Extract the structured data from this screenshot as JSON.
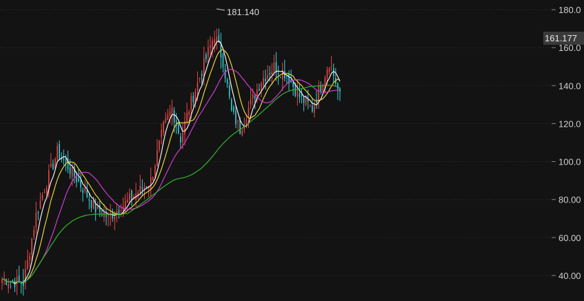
{
  "chart_data": {
    "type": "candlestick",
    "y_axis": {
      "ticks": [
        180,
        160,
        140,
        120,
        100,
        80,
        60,
        40
      ],
      "tick_labels": [
        "180.0",
        "160.0",
        "140.0",
        "120.0",
        "100.0",
        "80.00",
        "60.00",
        "40.00"
      ],
      "ylim": [
        33,
        183
      ],
      "position": "right"
    },
    "grid": "horizontal-dotted",
    "annotations": {
      "peak_label": "181.140",
      "peak_value": 181.14,
      "current_price_label": "161.177",
      "current_price": 161.177
    },
    "bar_count": 160,
    "price_path_anchors": [
      [
        0,
        38
      ],
      [
        10,
        36
      ],
      [
        12,
        47
      ],
      [
        16,
        72
      ],
      [
        20,
        86
      ],
      [
        26,
        105
      ],
      [
        32,
        96
      ],
      [
        38,
        86
      ],
      [
        44,
        75
      ],
      [
        50,
        71
      ],
      [
        56,
        76
      ],
      [
        62,
        82
      ],
      [
        70,
        90
      ],
      [
        76,
        118
      ],
      [
        80,
        128
      ],
      [
        84,
        112
      ],
      [
        88,
        128
      ],
      [
        94,
        148
      ],
      [
        100,
        167
      ],
      [
        104,
        153
      ],
      [
        108,
        126
      ],
      [
        112,
        117
      ],
      [
        116,
        128
      ],
      [
        122,
        143
      ],
      [
        128,
        150
      ],
      [
        134,
        146
      ],
      [
        140,
        134
      ],
      [
        146,
        128
      ],
      [
        150,
        140
      ],
      [
        154,
        153
      ],
      [
        158,
        138
      ],
      [
        159,
        134
      ]
    ],
    "moving_averages": [
      {
        "color": "#f2f2f2",
        "period": 5
      },
      {
        "color": "#e8d53a",
        "period": 10
      },
      {
        "color": "#d33ad3",
        "period": 20
      },
      {
        "color": "#2fb52f",
        "period": 60
      }
    ],
    "colors": {
      "up": "#e84848",
      "down": "#3ad0d8",
      "background": "#131313",
      "grid": "#3a3a3a",
      "current_price_bg": "#3a3a3a"
    }
  }
}
